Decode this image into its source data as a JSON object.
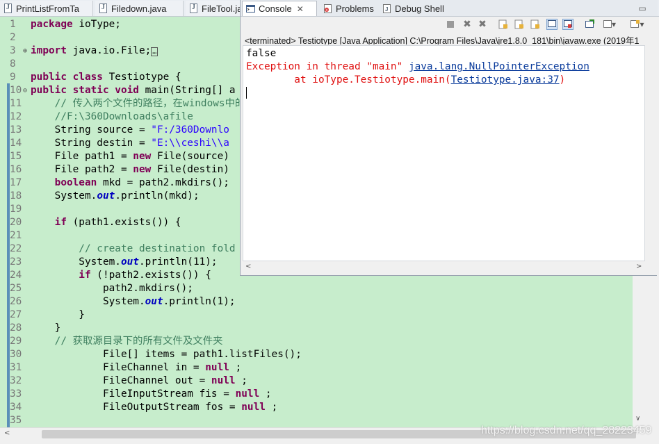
{
  "editor_tabs": [
    "PrintListFromTa",
    "Filedown.java",
    "FileTool.ja"
  ],
  "console_tabs": {
    "console": "Console",
    "problems": "Problems",
    "debug_shell": "Debug Shell"
  },
  "console_header": "<terminated> Testiotype [Java Application] C:\\Program Files\\Java\\jre1.8.0_181\\bin\\javaw.exe (2019年1",
  "console_output": {
    "line1": "false",
    "exception_prefix": "Exception in thread \"main\" ",
    "exception_link": "java.lang.NullPointerException",
    "at_prefix": "        at ioType.Testiotype.main(",
    "at_link": "Testiotype.java:37",
    "at_suffix": ")"
  },
  "icons": {
    "tab_file": "java-file-icon",
    "console": "console-icon",
    "problems": "problems-icon",
    "debug_shell": "debug-shell-icon",
    "toolbar": [
      "terminate-icon",
      "remove-launch-icon",
      "remove-all-icon",
      "scroll-lock-icon",
      "word-wrap-icon",
      "show-stdout-icon",
      "show-stderr-icon",
      "pin-console-icon",
      "display-console-icon",
      "open-console-icon"
    ]
  },
  "code_lines": [
    {
      "n": "1",
      "y": 0,
      "t": [
        [
          "kw",
          "package"
        ],
        [
          "",
          "ioType;"
        ]
      ]
    },
    {
      "n": "2",
      "y": 1,
      "t": []
    },
    {
      "n": "3",
      "y": 2,
      "fold": "+",
      "t": [
        [
          "kw",
          "import"
        ],
        [
          "",
          "java.io.File;"
        ],
        [
          "box",
          "…"
        ]
      ]
    },
    {
      "n": "8",
      "y": 3,
      "t": []
    },
    {
      "n": "9",
      "y": 4,
      "t": [
        [
          "kw",
          "public class"
        ],
        [
          "",
          "Testiotype {"
        ]
      ]
    },
    {
      "n": "10",
      "y": 5,
      "fold": "-",
      "t": [
        [
          "kw",
          "public static void"
        ],
        [
          "",
          "main(String[] a"
        ]
      ]
    },
    {
      "n": "11",
      "y": 6,
      "t": [
        [
          "cm",
          "    // 传入两个文件的路径，在windows中的分隔"
        ]
      ]
    },
    {
      "n": "12",
      "y": 7,
      "t": [
        [
          "cm",
          "    //F:\\360Downloads\\afile"
        ]
      ]
    },
    {
      "n": "13",
      "y": 8,
      "t": [
        [
          "",
          "    String source = "
        ],
        [
          "st",
          "\"F:/360Downlo"
        ]
      ]
    },
    {
      "n": "14",
      "y": 9,
      "t": [
        [
          "",
          "    String destin = "
        ],
        [
          "st",
          "\"E:\\\\ceshi\\\\a"
        ]
      ]
    },
    {
      "n": "15",
      "y": 10,
      "t": [
        [
          "",
          "    File path1 = "
        ],
        [
          "kw",
          "new"
        ],
        [
          "",
          " File(source)"
        ]
      ]
    },
    {
      "n": "16",
      "y": 11,
      "t": [
        [
          "",
          "    File path2 = "
        ],
        [
          "kw",
          "new"
        ],
        [
          "",
          " File(destin)"
        ]
      ]
    },
    {
      "n": "17",
      "y": 12,
      "t": [
        [
          "kw",
          "    boolean"
        ],
        [
          "",
          " mkd = path2.mkdirs();"
        ]
      ]
    },
    {
      "n": "18",
      "y": 13,
      "t": [
        [
          "",
          "    System."
        ],
        [
          "fld",
          "out"
        ],
        [
          "",
          ".println(mkd);"
        ]
      ]
    },
    {
      "n": "19",
      "y": 14,
      "t": []
    },
    {
      "n": "20",
      "y": 15,
      "t": [
        [
          "kw",
          "    if"
        ],
        [
          "",
          " (path1.exists()) {"
        ]
      ]
    },
    {
      "n": "21",
      "y": 16,
      "t": []
    },
    {
      "n": "22",
      "y": 17,
      "t": [
        [
          "cm",
          "        // create destination fold"
        ]
      ]
    },
    {
      "n": "23",
      "y": 18,
      "t": [
        [
          "",
          "        System."
        ],
        [
          "fld",
          "out"
        ],
        [
          "",
          ".println(11);"
        ]
      ]
    },
    {
      "n": "24",
      "y": 19,
      "t": [
        [
          "kw",
          "        if"
        ],
        [
          "",
          " (!path2.exists()) {"
        ]
      ]
    },
    {
      "n": "25",
      "y": 20,
      "t": [
        [
          "",
          "            path2.mkdirs();"
        ]
      ]
    },
    {
      "n": "26",
      "y": 21,
      "t": [
        [
          "",
          "            System."
        ],
        [
          "fld",
          "out"
        ],
        [
          "",
          ".println(1);"
        ]
      ]
    },
    {
      "n": "27",
      "y": 22,
      "t": [
        [
          "",
          "        }"
        ]
      ]
    },
    {
      "n": "28",
      "y": 23,
      "t": [
        [
          "",
          "    }"
        ]
      ]
    },
    {
      "n": "29",
      "y": 24,
      "t": [
        [
          "cm",
          "    // 获取源目录下的所有文件及文件夹"
        ]
      ]
    },
    {
      "n": "30",
      "y": 25,
      "t": [
        [
          "",
          "            File[] items = path1.listFiles();"
        ]
      ]
    },
    {
      "n": "31",
      "y": 26,
      "t": [
        [
          "",
          "            FileChannel in = "
        ],
        [
          "kw",
          "null"
        ],
        [
          "",
          ";"
        ]
      ]
    },
    {
      "n": "32",
      "y": 27,
      "t": [
        [
          "",
          "            FileChannel out = "
        ],
        [
          "kw",
          "null"
        ],
        [
          "",
          ";"
        ]
      ]
    },
    {
      "n": "33",
      "y": 28,
      "t": [
        [
          "",
          "            FileInputStream fis = "
        ],
        [
          "kw",
          "null"
        ],
        [
          "",
          ";"
        ]
      ]
    },
    {
      "n": "34",
      "y": 29,
      "t": [
        [
          "",
          "            FileOutputStream fos = "
        ],
        [
          "kw",
          "null"
        ],
        [
          "",
          ";"
        ]
      ]
    },
    {
      "n": "35",
      "y": 30,
      "t": []
    }
  ],
  "watermark": "https://blog.csdn.net/qq_28223459"
}
